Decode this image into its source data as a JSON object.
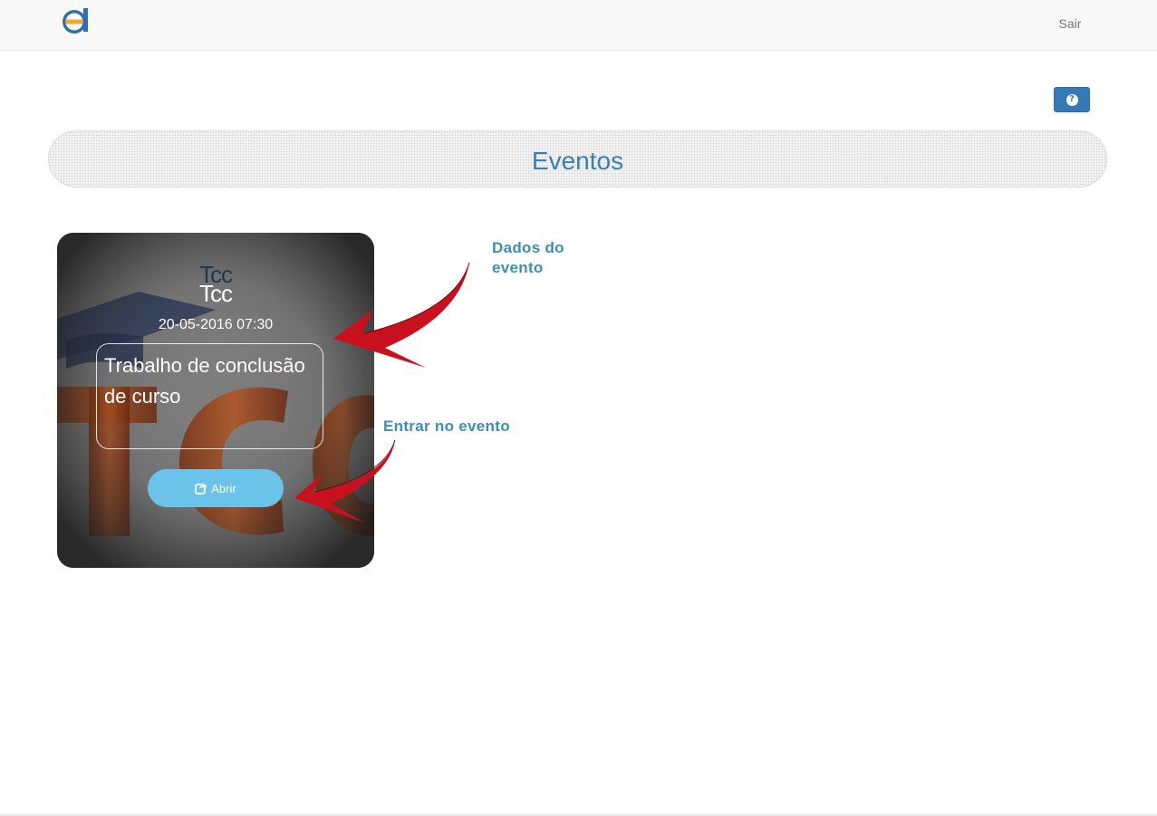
{
  "navbar": {
    "logo_icon": "app-logo-icon",
    "logout_label": "Sair"
  },
  "toolbar": {
    "help_icon": "question-circle-icon",
    "help_color": "#337ab7"
  },
  "page": {
    "title": "Eventos"
  },
  "events": [
    {
      "title": "Tcc",
      "datetime": "20-05-2016 07:30",
      "description": "Trabalho de conclusão de curso",
      "open_label": "Abrir",
      "open_icon": "share-square-icon",
      "open_color": "#6cc3ea"
    }
  ],
  "annotations": {
    "event_data": "Dados do evento",
    "enter_event": "Entrar no evento",
    "color": "#3d8fae",
    "arrow_color": "#c8101e"
  }
}
